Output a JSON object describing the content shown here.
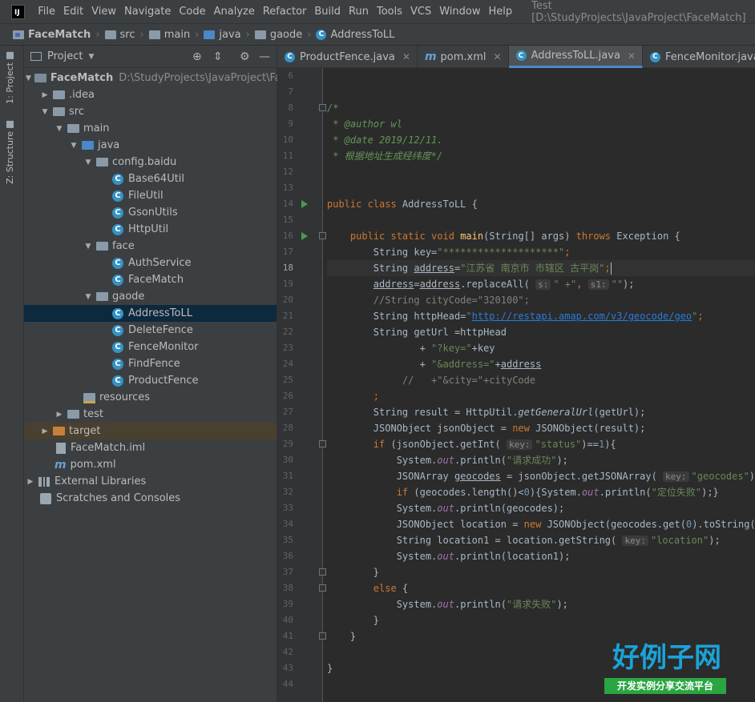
{
  "app": {
    "logo_text": "IJ"
  },
  "menu": [
    "File",
    "Edit",
    "View",
    "Navigate",
    "Code",
    "Analyze",
    "Refactor",
    "Build",
    "Run",
    "Tools",
    "VCS",
    "Window",
    "Help"
  ],
  "window_title": "Test [D:\\StudyProjects\\JavaProject\\FaceMatch]",
  "breadcrumb": [
    "FaceMatch",
    "src",
    "main",
    "java",
    "gaode",
    "AddressToLL"
  ],
  "side_tabs": [
    "1: Project",
    "Z: Structure"
  ],
  "project_panel": {
    "title": "Project",
    "tree": [
      {
        "label": "FaceMatch",
        "hint": "D:\\StudyProjects\\JavaProject\\FaceM"
      },
      {
        "label": ".idea"
      },
      {
        "label": "src"
      },
      {
        "label": "main"
      },
      {
        "label": "java"
      },
      {
        "label": "config.baidu"
      },
      {
        "label": "Base64Util"
      },
      {
        "label": "FileUtil"
      },
      {
        "label": "GsonUtils"
      },
      {
        "label": "HttpUtil"
      },
      {
        "label": "face"
      },
      {
        "label": "AuthService"
      },
      {
        "label": "FaceMatch"
      },
      {
        "label": "gaode"
      },
      {
        "label": "AddressToLL"
      },
      {
        "label": "DeleteFence"
      },
      {
        "label": "FenceMonitor"
      },
      {
        "label": "FindFence"
      },
      {
        "label": "ProductFence"
      },
      {
        "label": "resources"
      },
      {
        "label": "test"
      },
      {
        "label": "target"
      },
      {
        "label": "FaceMatch.iml"
      },
      {
        "label": "pom.xml"
      },
      {
        "label": "External Libraries"
      },
      {
        "label": "Scratches and Consoles"
      }
    ]
  },
  "tabs": [
    "ProductFence.java",
    "pom.xml",
    "AddressToLL.java",
    "FenceMonitor.java"
  ],
  "active_tab": "AddressToLL.java",
  "line_numbers": [
    "6",
    "7",
    "8",
    "9",
    "10",
    "11",
    "12",
    "13",
    "14",
    "15",
    "16",
    "17",
    "18",
    "19",
    "20",
    "21",
    "22",
    "23",
    "24",
    "25",
    "26",
    "27",
    "28",
    "29",
    "30",
    "31",
    "32",
    "33",
    "34",
    "35",
    "36",
    "37",
    "38",
    "39",
    "40",
    "41",
    "42",
    "43",
    "44"
  ],
  "current_line": "18",
  "code": {
    "l8a": "/*",
    "l9": " * @author wl",
    "l10": " * @date 2019/12/11.",
    "l11": " * 根据地址生成经纬度*/",
    "l14_kw": "public class ",
    "l14_rest": "AddressToLL {",
    "l16_kw": "public static void ",
    "l16_m": "main",
    "l16_a": "(String[] args) ",
    "l16_kw2": "throws ",
    "l16_b": "Exception {",
    "l17_a": "String key=",
    "l17_s": "\"********************\"",
    "l17_e": ";",
    "l18_a": "String ",
    "l18_v": "address",
    "l18_b": "=",
    "l18_s": "\"江苏省 南京市 市辖区 古平岗\"",
    "l18_e": ";",
    "l19_v1": "address",
    "l19_a": "=",
    "l19_v2": "address",
    "l19_b": ".replaceAll( ",
    "l19_h1": "s:",
    "l19_s1": "\" +\"",
    "l19_c": ", ",
    "l19_h2": "s1:",
    "l19_s2": "\"\"",
    "l19_e": ");",
    "l20": "//String cityCode=\"320100\";",
    "l21_a": "String httpHead=",
    "l21_q1": "\"",
    "l21_link": "http://restapi.amap.com/v3/geocode/geo",
    "l21_q2": "\"",
    "l21_e": ";",
    "l22": "String getUrl =httpHead",
    "l23_a": "        + ",
    "l23_s": "\"?key=\"",
    "l23_b": "+key",
    "l24_a": "        + ",
    "l24_s": "\"&address=\"",
    "l24_b": "+",
    "l24_v": "address",
    "l25": "     //   +\"&city=\"+cityCode",
    "l26": ";",
    "l27_a": "String result = HttpUtil.",
    "l27_m": "getGeneralUrl",
    "l27_b": "(getUrl);",
    "l28_a": "JSONObject jsonObject = ",
    "l28_kw": "new ",
    "l28_b": "JSONObject(result);",
    "l29_kw": "if ",
    "l29_a": "(jsonObject.getInt( ",
    "l29_h": "key:",
    "l29_s": "\"status\"",
    "l29_b": ")==",
    "l29_n": "1",
    "l29_c": "){",
    "l30_a": "System.",
    "l30_f": "out",
    "l30_b": ".println(",
    "l30_s": "\"请求成功\"",
    "l30_e": ");",
    "l31_a": "JSONArray ",
    "l31_v": "geocodes",
    "l31_b": " = jsonObject.getJSONArray( ",
    "l31_h": "key:",
    "l31_s": "\"geocodes\"",
    "l31_e": ");",
    "l32_kw": "if ",
    "l32_a": "(geocodes.length()<",
    "l32_n": "0",
    "l32_b": "){System.",
    "l32_f": "out",
    "l32_c": ".println(",
    "l32_s": "\"定位失败\"",
    "l32_e": ");}",
    "l33_a": "System.",
    "l33_f": "out",
    "l33_b": ".println(geocodes);",
    "l34_a": "JSONObject location = ",
    "l34_kw": "new ",
    "l34_b": "JSONObject(geocodes.get(",
    "l34_n": "0",
    "l34_c": ").toString());",
    "l35_a": "String location1 = location.getString( ",
    "l35_h": "key:",
    "l35_s": "\"location\"",
    "l35_e": ");",
    "l36_a": "System.",
    "l36_f": "out",
    "l36_b": ".println(location1);",
    "l37": "}",
    "l38_kw": "else ",
    "l38_a": "{",
    "l39_a": "System.",
    "l39_f": "out",
    "l39_b": ".println(",
    "l39_s": "\"请求失败\"",
    "l39_e": ");",
    "l40": "}",
    "l41": "}",
    "l43": "}"
  },
  "watermark": {
    "title": "好例子网",
    "subtitle": "开发实例分享交流平台"
  }
}
